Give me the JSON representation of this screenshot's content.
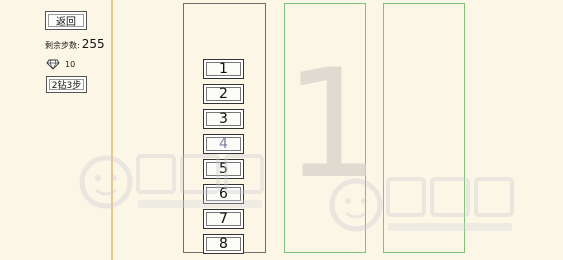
{
  "controls": {
    "back_label": "返回",
    "steps_label": "剩余步数:",
    "steps_value": "255",
    "gems": "10",
    "hint_label": "2钻3步"
  },
  "big_number": "1",
  "tiles": [
    "1",
    "2",
    "3",
    "4",
    "5",
    "6",
    "7",
    "8"
  ],
  "colors": {
    "background": "#fbf6e6",
    "divider": "#e8c98d",
    "active_column_border": "#7dc277",
    "source_column_border": "#6e6e6e"
  }
}
